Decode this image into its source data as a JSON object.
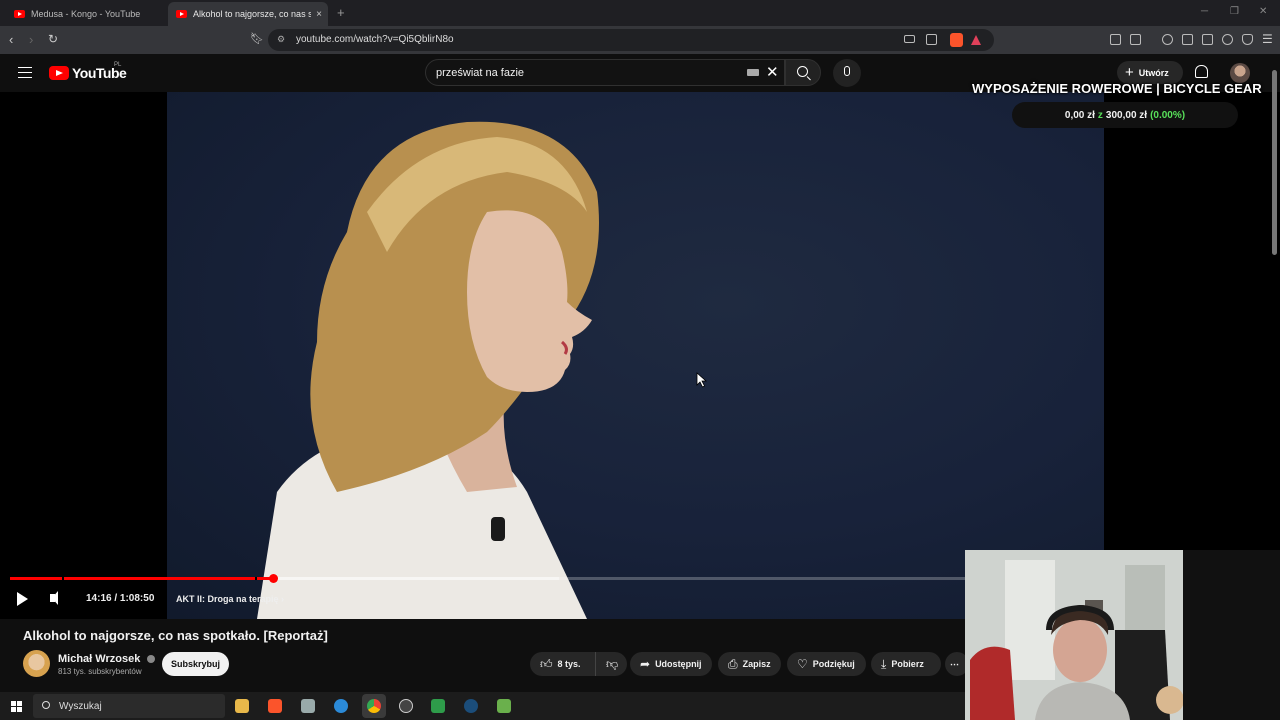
{
  "browser": {
    "tabs": [
      {
        "title": "Medusa - Kongo - YouTube",
        "active": false
      },
      {
        "title": "Alkohol to najgorsze, co nas spo",
        "active": true
      }
    ],
    "new_tab": "+",
    "close": "×",
    "url": "youtube.com/watch?v=Qi5QblirN8o"
  },
  "youtube": {
    "logo_text": "YouTube",
    "country_code": "PL",
    "search_value": "przeświat na fazie",
    "create_label": "Utwórz"
  },
  "overlay": {
    "title": "WYPOSAŻENIE ROWEROWE | BICYCLE GEAR",
    "amount": "0,00 zł",
    "of": "z",
    "goal": "300,00 zł",
    "percent": "(0.00%)"
  },
  "player": {
    "time": "14:16 / 1:08:50",
    "chapter": "AKT II: Droga na terapię",
    "played_fraction": 0.275,
    "buffered_fraction": 0.575
  },
  "video": {
    "title": "Alkohol to najgorsze, co nas spotkało. [Reportaż]",
    "channel": "Michał Wrzosek",
    "subscribers": "813 tys. subskrybentów",
    "subscribe_label": "Subskrybuj",
    "likes": "8 tys.",
    "share": "Udostępnij",
    "save": "Zapisz",
    "thanks": "Podziękuj",
    "download": "Pobierz",
    "more": "⋯"
  },
  "taskbar": {
    "search_placeholder": "Wyszukaj"
  },
  "colors": {
    "brand_red": "#ff0000",
    "overlay_green": "#58e05a",
    "background": "#0f0f0f"
  }
}
